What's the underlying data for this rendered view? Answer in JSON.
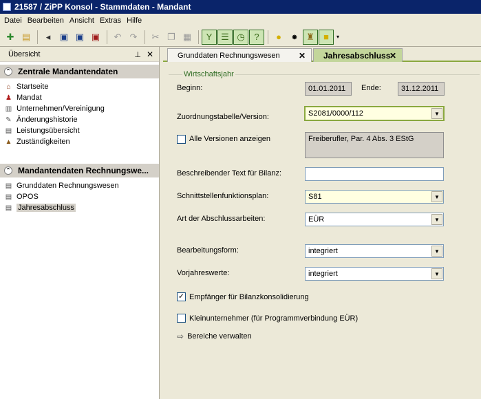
{
  "window": {
    "title": "21587 / ZiPP Konsol - Stammdaten - Mandant"
  },
  "menu": [
    "Datei",
    "Bearbeiten",
    "Ansicht",
    "Extras",
    "Hilfe"
  ],
  "toolbar_icons": [
    "new-icon",
    "open-folder-icon",
    "back-icon",
    "save-icon",
    "save-as-icon",
    "save-close-icon",
    "undo-icon",
    "redo-icon",
    "cut-icon",
    "copy-icon",
    "paste-icon",
    "tree-icon",
    "list-icon",
    "history-icon",
    "help-icon",
    "lightbulb-icon",
    "lex-icon",
    "mandant-icon",
    "note-icon"
  ],
  "left": {
    "header": "Übersicht",
    "sections": [
      {
        "title": "Zentrale Mandantendaten",
        "items": [
          "Startseite",
          "Mandat",
          "Unternehmen/Vereinigung",
          "Änderungshistorie",
          "Leistungsübersicht",
          "Zuständigkeiten"
        ]
      },
      {
        "title": "Mandantendaten Rechnungswe...",
        "items": [
          "Grunddaten Rechnungswesen",
          "OPOS",
          "Jahresabschluss"
        ]
      }
    ]
  },
  "tabs": [
    {
      "label": "Grunddaten Rechnungswesen",
      "active": false
    },
    {
      "label": "Jahresabschluss",
      "active": true
    }
  ],
  "form": {
    "group_label": "Wirtschaftsjahr",
    "beginn_label": "Beginn:",
    "beginn_value": "01.01.2011",
    "ende_label": "Ende:",
    "ende_value": "31.12.2011",
    "zuordnung_label": "Zuordnungstabelle/Version:",
    "zuordnung_value": "S2081/0000/112",
    "alle_versionen_label": "Alle Versionen anzeigen",
    "alle_versionen_checked": false,
    "version_description": "Freiberufler, Par. 4 Abs. 3 EStG",
    "text_bilanz_label": "Beschreibender Text für Bilanz:",
    "text_bilanz_value": "",
    "schnittstelle_label": "Schnittstellenfunktionsplan:",
    "schnittstelle_value": "S81",
    "art_label": "Art der Abschlussarbeiten:",
    "art_value": "EÜR",
    "bearbeitung_label": "Bearbeitungsform:",
    "bearbeitung_value": "integriert",
    "vorjahr_label": "Vorjahreswerte:",
    "vorjahr_value": "integriert",
    "empfaenger_label": "Empfänger für Bilanzkonsolidierung",
    "empfaenger_checked": true,
    "kleinunternehmer_label": "Kleinunternehmer  (für  Programmverbindung  EÜR)",
    "kleinunternehmer_checked": false,
    "bereiche_link": "Bereiche verwalten"
  }
}
